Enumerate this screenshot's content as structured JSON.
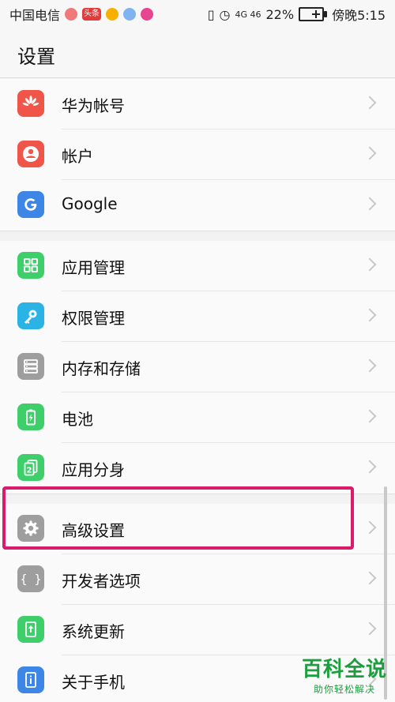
{
  "status_bar": {
    "carrier": "中国电信",
    "signal": "4G 46",
    "battery_percent": "22%",
    "time": "傍晚5:15",
    "notif_badge": "头条"
  },
  "header": {
    "title": "设置"
  },
  "settings": {
    "groups": [
      {
        "items": [
          {
            "label": "华为帐号",
            "icon": "huawei-logo-icon",
            "color": "#f0554a"
          },
          {
            "label": "帐户",
            "icon": "account-icon",
            "color": "#f0554a"
          },
          {
            "label": "Google",
            "icon": "google-icon",
            "color": "#3d86e6"
          }
        ]
      },
      {
        "items": [
          {
            "label": "应用管理",
            "icon": "apps-grid-icon",
            "color": "#3fcf6a"
          },
          {
            "label": "权限管理",
            "icon": "key-icon",
            "color": "#2bb3e6"
          },
          {
            "label": "内存和存储",
            "icon": "storage-icon",
            "color": "#9e9e9e"
          },
          {
            "label": "电池",
            "icon": "battery-icon",
            "color": "#3fcf6a"
          },
          {
            "label": "应用分身",
            "icon": "app-twin-icon",
            "color": "#3fcf6a"
          }
        ]
      },
      {
        "items": [
          {
            "label": "高级设置",
            "icon": "gear-icon",
            "color": "#9e9e9e"
          },
          {
            "label": "开发者选项",
            "icon": "braces-icon",
            "color": "#9e9e9e"
          },
          {
            "label": "系统更新",
            "icon": "system-update-icon",
            "color": "#3fcf6a"
          },
          {
            "label": "关于手机",
            "icon": "about-phone-icon",
            "color": "#3d86e6"
          }
        ]
      }
    ]
  },
  "watermark": {
    "main": "百科全说",
    "sub": "助你轻松解决"
  }
}
